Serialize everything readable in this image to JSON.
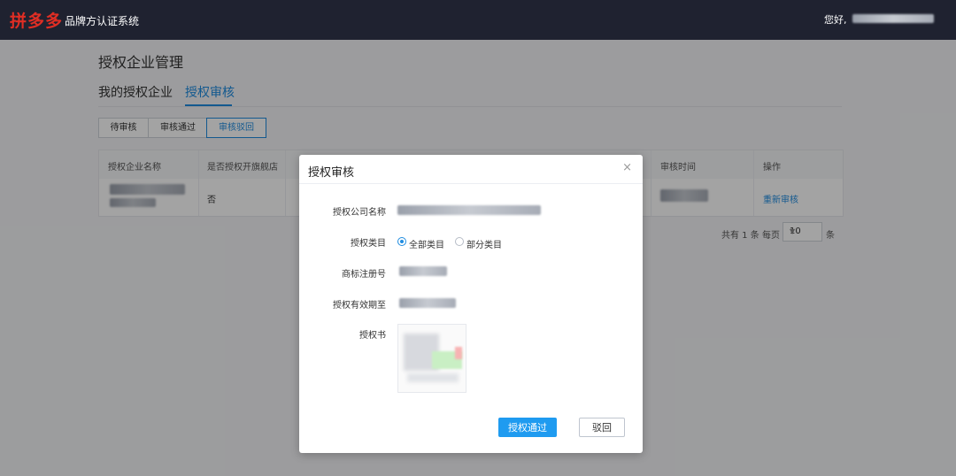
{
  "header": {
    "logo_text": "拼多多",
    "system_name": "品牌方认证系统",
    "greeting": "您好,"
  },
  "page": {
    "title": "授权企业管理",
    "tabs": [
      {
        "label": "我的授权企业",
        "active": false
      },
      {
        "label": "授权审核",
        "active": true
      }
    ],
    "status_filters": [
      {
        "label": "待审核",
        "active": false
      },
      {
        "label": "审核通过",
        "active": false
      },
      {
        "label": "审核驳回",
        "active": true
      }
    ]
  },
  "table": {
    "columns": [
      "授权企业名称",
      "是否授权开旗舰店",
      "审核时间",
      "操作"
    ],
    "rows": [
      {
        "flagship_store": "否",
        "action": "重新审核"
      }
    ]
  },
  "pagination": {
    "total_text": "共有 1 条",
    "per_page_label": "每页",
    "per_page_value": "10",
    "unit": "条"
  },
  "modal": {
    "title": "授权审核",
    "close_icon": "×",
    "fields": {
      "company_label": "授权公司名称",
      "category_label": "授权类目",
      "trademark_label": "商标注册号",
      "validity_label": "授权有效期至",
      "certificate_label": "授权书"
    },
    "category_options": [
      {
        "label": "全部类目",
        "selected": true
      },
      {
        "label": "部分类目",
        "selected": false
      }
    ],
    "approve_button": "授权通过",
    "reject_button": "驳回"
  },
  "colors": {
    "accent": "#1f8ce0",
    "topbar": "#1f2230",
    "brand": "#e02e24"
  }
}
